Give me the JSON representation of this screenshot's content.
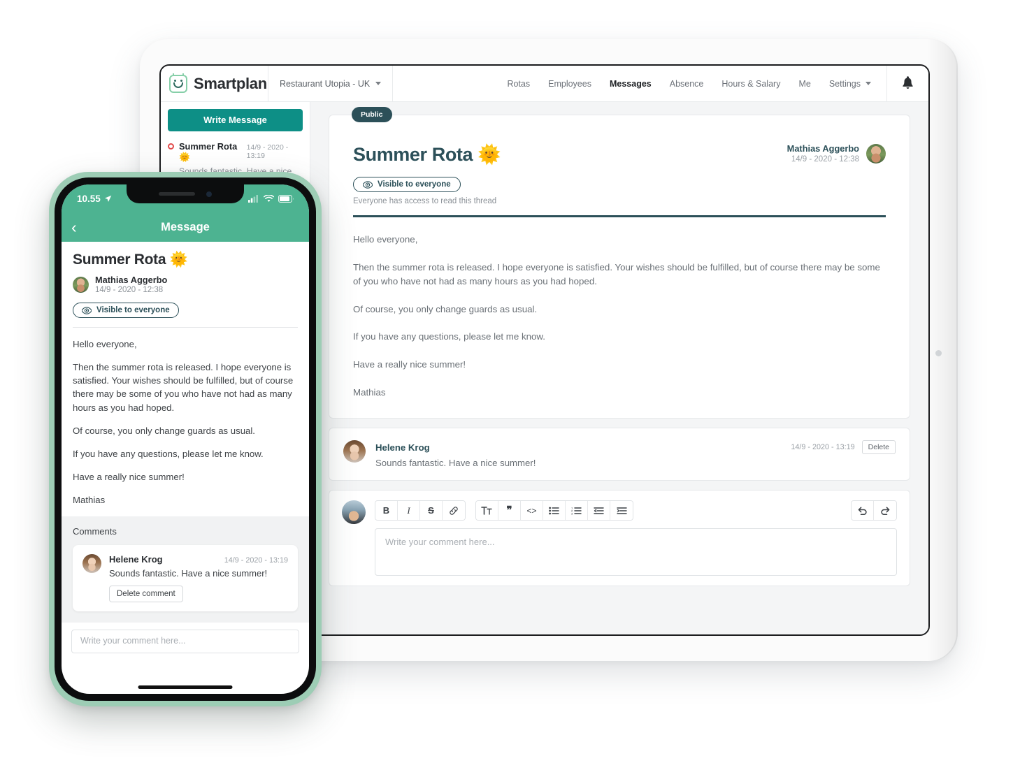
{
  "tablet": {
    "brand": "Smartplan",
    "org": {
      "label": "Restaurant Utopia - UK",
      "caret": "chevron-down-icon"
    },
    "nav": [
      {
        "label": "Rotas",
        "active": false
      },
      {
        "label": "Employees",
        "active": false
      },
      {
        "label": "Messages",
        "active": true
      },
      {
        "label": "Absence",
        "active": false
      },
      {
        "label": "Hours & Salary",
        "active": false
      },
      {
        "label": "Me",
        "active": false
      },
      {
        "label": "Settings",
        "active": false
      }
    ],
    "bell_icon": "notification-bell-icon",
    "sidebar": {
      "write_button": "Write Message",
      "thread": {
        "title": "Summer Rota 🌞",
        "date": "14/9 - 2020 - 13:19",
        "preview": "Sounds fantastic. Have a nice summer!"
      }
    },
    "post": {
      "badge": "Public",
      "title": "Summer Rota 🌞",
      "author_name": "Mathias Aggerbo",
      "author_date": "14/9 - 2020 - 12:38",
      "visibility_pill": "Visible to everyone",
      "visibility_icon": "eye-icon",
      "visibility_note": "Everyone has access to read this thread",
      "paragraphs": [
        "Hello everyone,",
        "Then the summer rota is released. I hope everyone is satisfied. Your wishes should be fulfilled, but of course there may be some of you who have not had as many hours as you had hoped.",
        "Of course, you only change guards as usual.",
        "If you have any questions, please let me know.",
        "Have a really nice summer!",
        "Mathias"
      ]
    },
    "comment": {
      "name": "Helene Krog",
      "date": "14/9 - 2020 - 13:19",
      "delete_label": "Delete",
      "text": "Sounds fantastic. Have a nice summer!"
    },
    "editor": {
      "placeholder": "Write your comment here...",
      "tools_group1": [
        {
          "icon": "bold-icon",
          "glyph": "B"
        },
        {
          "icon": "italic-icon",
          "glyph": "I"
        },
        {
          "icon": "strikethrough-icon",
          "glyph": "S"
        },
        {
          "icon": "link-icon",
          "glyph": "🔗"
        }
      ],
      "tools_group2": [
        {
          "icon": "text-size-icon",
          "glyph": "T"
        },
        {
          "icon": "blockquote-icon",
          "glyph": "❞"
        },
        {
          "icon": "code-icon",
          "glyph": "<>"
        },
        {
          "icon": "bullet-list-icon",
          "glyph": "☰"
        },
        {
          "icon": "numbered-list-icon",
          "glyph": "☰"
        },
        {
          "icon": "outdent-icon",
          "glyph": "⇤"
        },
        {
          "icon": "indent-icon",
          "glyph": "⇥"
        }
      ],
      "tools_group3": [
        {
          "icon": "undo-icon",
          "glyph": "↰"
        },
        {
          "icon": "redo-icon",
          "glyph": "↱"
        }
      ]
    }
  },
  "phone": {
    "status": {
      "time": "10.55",
      "location_icon": "location-arrow-icon",
      "signal_icon": "cellular-signal-icon",
      "wifi_icon": "wifi-icon",
      "battery_icon": "battery-icon"
    },
    "header": {
      "back_icon": "back-chevron-icon",
      "title": "Message"
    },
    "post": {
      "title": "Summer Rota 🌞",
      "author_name": "Mathias Aggerbo",
      "author_date": "14/9 - 2020 - 12:38",
      "visibility_pill": "Visible to everyone",
      "visibility_icon": "eye-icon",
      "paragraphs": [
        "Hello everyone,",
        "Then the summer rota is released. I hope everyone is satisfied. Your wishes should be fulfilled, but of course there may be some of you who have not had as many hours as you had hoped.",
        "Of course, you only change guards as usual.",
        "If you have any questions, please let me know.",
        "Have a really nice summer!",
        "Mathias"
      ]
    },
    "comments_heading": "Comments",
    "comment": {
      "name": "Helene Krog",
      "date": "14/9 - 2020 - 13:19",
      "text": "Sounds fantastic. Have a nice summer!",
      "delete_label": "Delete comment"
    },
    "input_placeholder": "Write your comment here..."
  },
  "colors": {
    "teal_button": "#0d8f86",
    "dark_teal": "#2c5059",
    "phone_green": "#4db391",
    "phone_frame": "#9dcdb5",
    "unread_dot": "#e24b4b"
  }
}
